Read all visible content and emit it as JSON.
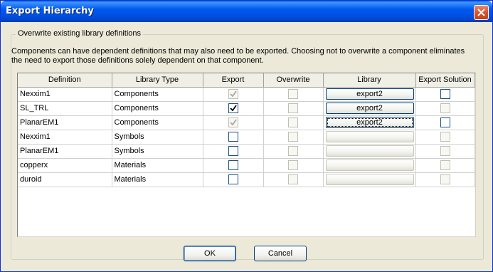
{
  "window": {
    "title": "Export Hierarchy",
    "close_icon": "close-icon",
    "accent_color": "#0058ee"
  },
  "group": {
    "label": "Overwrite existing library definitions",
    "description_line1": "Components can have dependent definitions that may also need to be exported. Choosing not to overwrite a component eliminates",
    "description_line2": "the need to export those definitions solely dependent on that component."
  },
  "table": {
    "columns": [
      "Definition",
      "Library Type",
      "Export",
      "Overwrite",
      "Library",
      "Export Solution"
    ],
    "rows": [
      {
        "definition": "Nexxim1",
        "library_type": "Components",
        "export": "checked-disabled",
        "overwrite": "disabled",
        "library": "export2",
        "library_enabled": true,
        "export_solution": "enabled"
      },
      {
        "definition": "SL_TRL",
        "library_type": "Components",
        "export": "checked",
        "overwrite": "disabled",
        "library": "export2",
        "library_enabled": true,
        "export_solution": "disabled"
      },
      {
        "definition": "PlanarEM1",
        "library_type": "Components",
        "export": "checked-disabled",
        "overwrite": "disabled",
        "library": "export2",
        "library_enabled": true,
        "export_solution": "enabled"
      },
      {
        "definition": "Nexxim1",
        "library_type": "Symbols",
        "export": "unchecked",
        "overwrite": "disabled",
        "library": "",
        "library_enabled": false,
        "export_solution": "disabled"
      },
      {
        "definition": "PlanarEM1",
        "library_type": "Symbols",
        "export": "unchecked",
        "overwrite": "disabled",
        "library": "",
        "library_enabled": false,
        "export_solution": "disabled"
      },
      {
        "definition": "copperx",
        "library_type": "Materials",
        "export": "unchecked",
        "overwrite": "disabled",
        "library": "",
        "library_enabled": false,
        "export_solution": "disabled"
      },
      {
        "definition": "duroid",
        "library_type": "Materials",
        "export": "unchecked",
        "overwrite": "disabled",
        "library": "",
        "library_enabled": false,
        "export_solution": "disabled"
      }
    ]
  },
  "buttons": {
    "ok": "OK",
    "cancel": "Cancel"
  }
}
